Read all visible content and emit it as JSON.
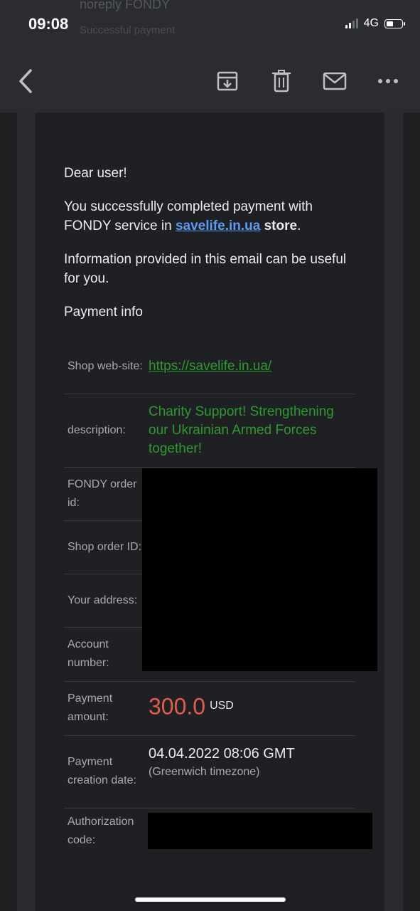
{
  "status": {
    "time": "09:08",
    "network": "4G"
  },
  "ghost_header": {
    "from": "noreply FONDY",
    "subject": "Successful payment"
  },
  "toolbar": {
    "back_icon": "chevron-left-icon",
    "archive_icon": "archive-icon",
    "trash_icon": "trash-icon",
    "mail_icon": "mail-icon",
    "more_icon": "more-icon"
  },
  "email": {
    "greeting": "Dear user!",
    "line1_prefix": "You successfully completed payment with FONDY service in ",
    "shop_link": "savelife.in.ua",
    "line1_store": "store",
    "line1_end": ".",
    "info_line": "Information provided in this email can be useful for you.",
    "section_title": "Payment info",
    "rows": {
      "website": {
        "label": "Shop web-site:",
        "value": "https://savelife.in.ua/"
      },
      "description": {
        "label": "description:",
        "value": "Charity Support! Strengthening our Ukrainian Armed Forces together!"
      },
      "order_id": {
        "label": "FONDY order id:"
      },
      "shop_order": {
        "label": "Shop order ID:"
      },
      "address": {
        "label": "Your address:"
      },
      "account": {
        "label": "Account number:"
      },
      "amount": {
        "label": "Payment amount:",
        "value": "300.0",
        "currency": "USD"
      },
      "date": {
        "label": "Payment creation date:",
        "value": "04.04.2022 08:06 GMT",
        "note": "(Greenwich timezone)"
      },
      "auth": {
        "label": "Authorization code:"
      }
    }
  },
  "colors": {
    "link_blue": "#5b9cf0",
    "green": "#2e9a2e",
    "amount_red": "#e35d4c",
    "background": "#1f2022"
  }
}
